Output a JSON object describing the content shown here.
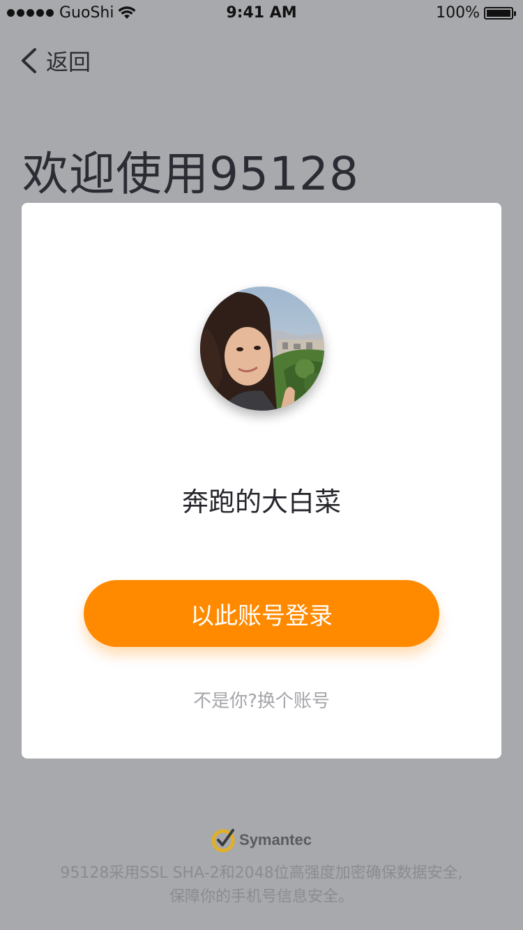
{
  "status_bar": {
    "carrier": "GuoShi",
    "time": "9:41 AM",
    "battery": "100%",
    "wifi_icon": "wifi-icon",
    "battery_icon": "battery-icon"
  },
  "nav": {
    "back_label": "返回",
    "back_icon": "chevron-left-icon"
  },
  "page": {
    "title": "欢迎使用95128"
  },
  "card": {
    "avatar_icon": "user-avatar",
    "username": "奔跑的大白菜",
    "login_button": "以此账号登录",
    "switch_account": "不是你?换个账号"
  },
  "footer": {
    "brand": "Symantec",
    "brand_icon": "symantec-check-icon",
    "note_line1": "95128采用SSL SHA-2和2048位高强度加密确保数据安全,",
    "note_line2": "保障你的手机号信息安全。"
  },
  "colors": {
    "background": "#a8a9ad",
    "card": "#ffffff",
    "accent": "#ff8a00",
    "title_text": "#2b2b33",
    "muted_text": "#a5a5aa"
  }
}
